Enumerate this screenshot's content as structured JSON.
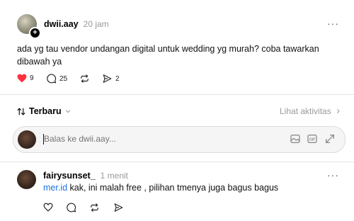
{
  "post": {
    "username": "dwii.aay",
    "time": "20 jam",
    "text": "ada yg tau vendor undangan digital untuk wedding yg murah? coba tawarkan dibawah ya",
    "likes": "9",
    "comments": "25",
    "shares": "2",
    "more_label": "···"
  },
  "sort": {
    "label": "Terbaru",
    "activity_label": "Lihat aktivitas"
  },
  "reply_box": {
    "placeholder": "Balas ke dwii.aay..."
  },
  "reply": {
    "username": "fairysunset_",
    "time": "1 menit",
    "mention": "mer.id",
    "text": " kak, ini malah free , pilihan tmenya juga bagus bagus",
    "more_label": "···"
  },
  "colors": {
    "like_red": "#ff3040",
    "mention_blue": "#1a73e8",
    "muted": "#9a9a9a"
  }
}
